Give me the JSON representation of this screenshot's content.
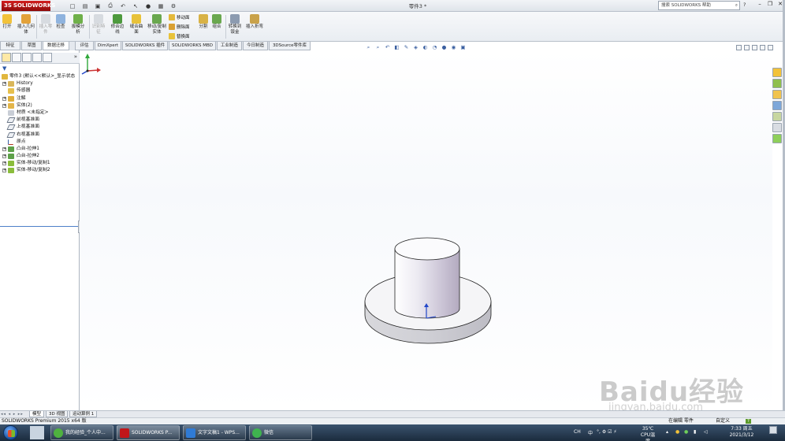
{
  "app": {
    "logo_text_prefix": "3S",
    "logo_text": "SOLIDWORKS",
    "document_title": "零件3 *",
    "search_placeholder": "搜索 SOLIDWORKS 帮助"
  },
  "toolbar": {
    "open": "打开",
    "insert_body": "插入几何体",
    "insert_part": "插入零件",
    "check": "检查",
    "draft_analysis": "拔模分析",
    "delete_feature": "识别特征",
    "combine_edges": "修合边线",
    "stitch_surface": "缝合曲面",
    "move_copy_body": "移动/复制实体",
    "move_face": "移动面",
    "delete_face": "删除面",
    "replace_face": "替换面",
    "split": "分割",
    "combine": "组合",
    "convert_to_sheetmetal": "转换到钣金",
    "insert_bends": "插入折弯"
  },
  "command_tabs": [
    "特征",
    "草图",
    "数据迁移",
    "评估",
    "DimXpert",
    "SOLIDWORKS 插件",
    "SOLIDWORKS MBD",
    "工业制造",
    "今日制造",
    "3DSource零件库"
  ],
  "feature_tree": {
    "root": "零件3 (默认<<默认>_显示状态",
    "items": [
      {
        "label": "History",
        "icon": "history-icon"
      },
      {
        "label": "传感器",
        "icon": "sensor-icon"
      },
      {
        "label": "注解",
        "icon": "annotation-icon"
      },
      {
        "label": "实体(2)",
        "icon": "solid-bodies-icon"
      },
      {
        "label": "材质 <未指定>",
        "icon": "material-icon"
      },
      {
        "label": "前视基准面",
        "icon": "plane-icon"
      },
      {
        "label": "上视基准面",
        "icon": "plane-icon"
      },
      {
        "label": "右视基准面",
        "icon": "plane-icon"
      },
      {
        "label": "原点",
        "icon": "origin-icon"
      },
      {
        "label": "凸台-拉伸1",
        "icon": "extrude-icon"
      },
      {
        "label": "凸台-拉伸2",
        "icon": "extrude-icon"
      },
      {
        "label": "实体-移动/复制1",
        "icon": "move-copy-icon"
      },
      {
        "label": "实体-移动/复制2",
        "icon": "move-copy-icon"
      }
    ]
  },
  "sheet_tabs": [
    "模型",
    "3D 视图",
    "运动算例 1"
  ],
  "status": {
    "left": "SOLIDWORKS Premium 2015 x64 版",
    "editing": "在编辑 零件",
    "units": "自定义",
    "help": "?"
  },
  "taskbar": {
    "buttons": [
      "我的经验_个人中...",
      "SOLIDWORKS P...",
      "文字文稿1 - WPS...",
      "微信"
    ],
    "tray_lang": "CH",
    "tray_ime": "中",
    "tray_ime_symbols": "°, ⚙ ☑ ⚡",
    "temperature": "35℃",
    "temperature_label": "CPU温度",
    "time": "7:33 周五",
    "date": "2021/3/12"
  },
  "watermark": {
    "main": "Baidu经验",
    "sub": "jingyan.baidu.com"
  },
  "colors": {
    "titlebar_accent": "#c0161a",
    "taskbar": "#24384f",
    "selection_blue": "#4d7fc9"
  }
}
